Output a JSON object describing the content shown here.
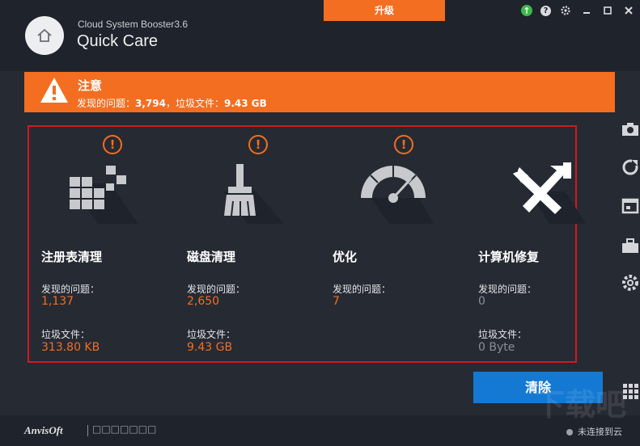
{
  "header": {
    "app_name": "Cloud System Booster3.6",
    "page_title": "Quick Care",
    "upgrade_label": "升级"
  },
  "alert": {
    "title": "注意",
    "detail_prefix": "发现的问题：",
    "issues_total": "3,794",
    "junk_prefix": "，垃圾文件：",
    "junk_total": "9.43 GB"
  },
  "categories": [
    {
      "title": "注册表清理",
      "issues_label": "发现的问题：",
      "issues_value": "1,137",
      "junk_label": "垃圾文件：",
      "junk_value": "313.80 KB",
      "icon": "registry-blocks-icon",
      "has_warning": true
    },
    {
      "title": "磁盘清理",
      "issues_label": "发现的问题：",
      "issues_value": "2,650",
      "junk_label": "垃圾文件：",
      "junk_value": "9.43 GB",
      "icon": "broom-icon",
      "has_warning": true
    },
    {
      "title": "优化",
      "issues_label": "发现的问题：",
      "issues_value": "7",
      "icon": "speedometer-icon",
      "has_warning": true
    },
    {
      "title": "计算机修复",
      "issues_label": "发现的问题：",
      "issues_value": "0",
      "junk_label": "垃圾文件：",
      "junk_value": "0 Byte",
      "icon": "wrench-hammer-icon",
      "has_warning": false
    }
  ],
  "actions": {
    "clean_label": "清除"
  },
  "footer": {
    "brand": "AnvisOft",
    "brand_boxes": "□□□□□□□",
    "cloud_status": "未连接到云"
  },
  "watermark": "下载吧",
  "colors": {
    "accent": "#f36e21",
    "primary_button": "#1479d3",
    "panel_border": "#d01a1f",
    "background": "#262a33"
  }
}
